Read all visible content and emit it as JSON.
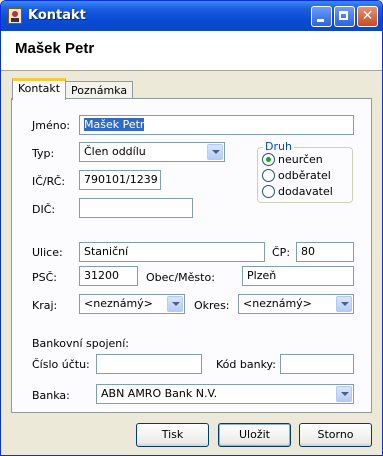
{
  "window": {
    "title": "Kontakt"
  },
  "header": {
    "name": "Mašek Petr"
  },
  "tabs": [
    {
      "label": "Kontakt",
      "active": true
    },
    {
      "label": "Poznámka",
      "active": false
    }
  ],
  "form": {
    "jmeno": {
      "label": "Jméno:",
      "value": "Mašek Petr"
    },
    "typ": {
      "label": "Typ:",
      "value": "Člen oddílu"
    },
    "ic_rc": {
      "label": "IČ/RČ:",
      "value": "790101/1239"
    },
    "dic": {
      "label": "DIČ:",
      "value": ""
    },
    "druh": {
      "title": "Druh",
      "options": [
        "neurčen",
        "odběratel",
        "dodavatel"
      ],
      "selected": "neurčen"
    },
    "ulice": {
      "label": "Ulice:",
      "value": "Staniční"
    },
    "cp": {
      "label": "ČP:",
      "value": "80"
    },
    "psc": {
      "label": "PSČ:",
      "value": "31200"
    },
    "obec": {
      "label": "Obec/Město:",
      "value": "Plzeň"
    },
    "kraj": {
      "label": "Kraj:",
      "value": "<neznámý>"
    },
    "okres": {
      "label": "Okres:",
      "value": "<neznámý>"
    },
    "bank_section": "Bankovní spojení:",
    "cislo_uctu": {
      "label": "Číslo účtu:",
      "value": ""
    },
    "kod_banky": {
      "label": "Kód banky:",
      "value": ""
    },
    "banka": {
      "label": "Banka:",
      "value": "ABN AMRO Bank N.V."
    }
  },
  "buttons": {
    "tisk": "Tisk",
    "ulozit": "Uložit",
    "storno": "Storno"
  }
}
